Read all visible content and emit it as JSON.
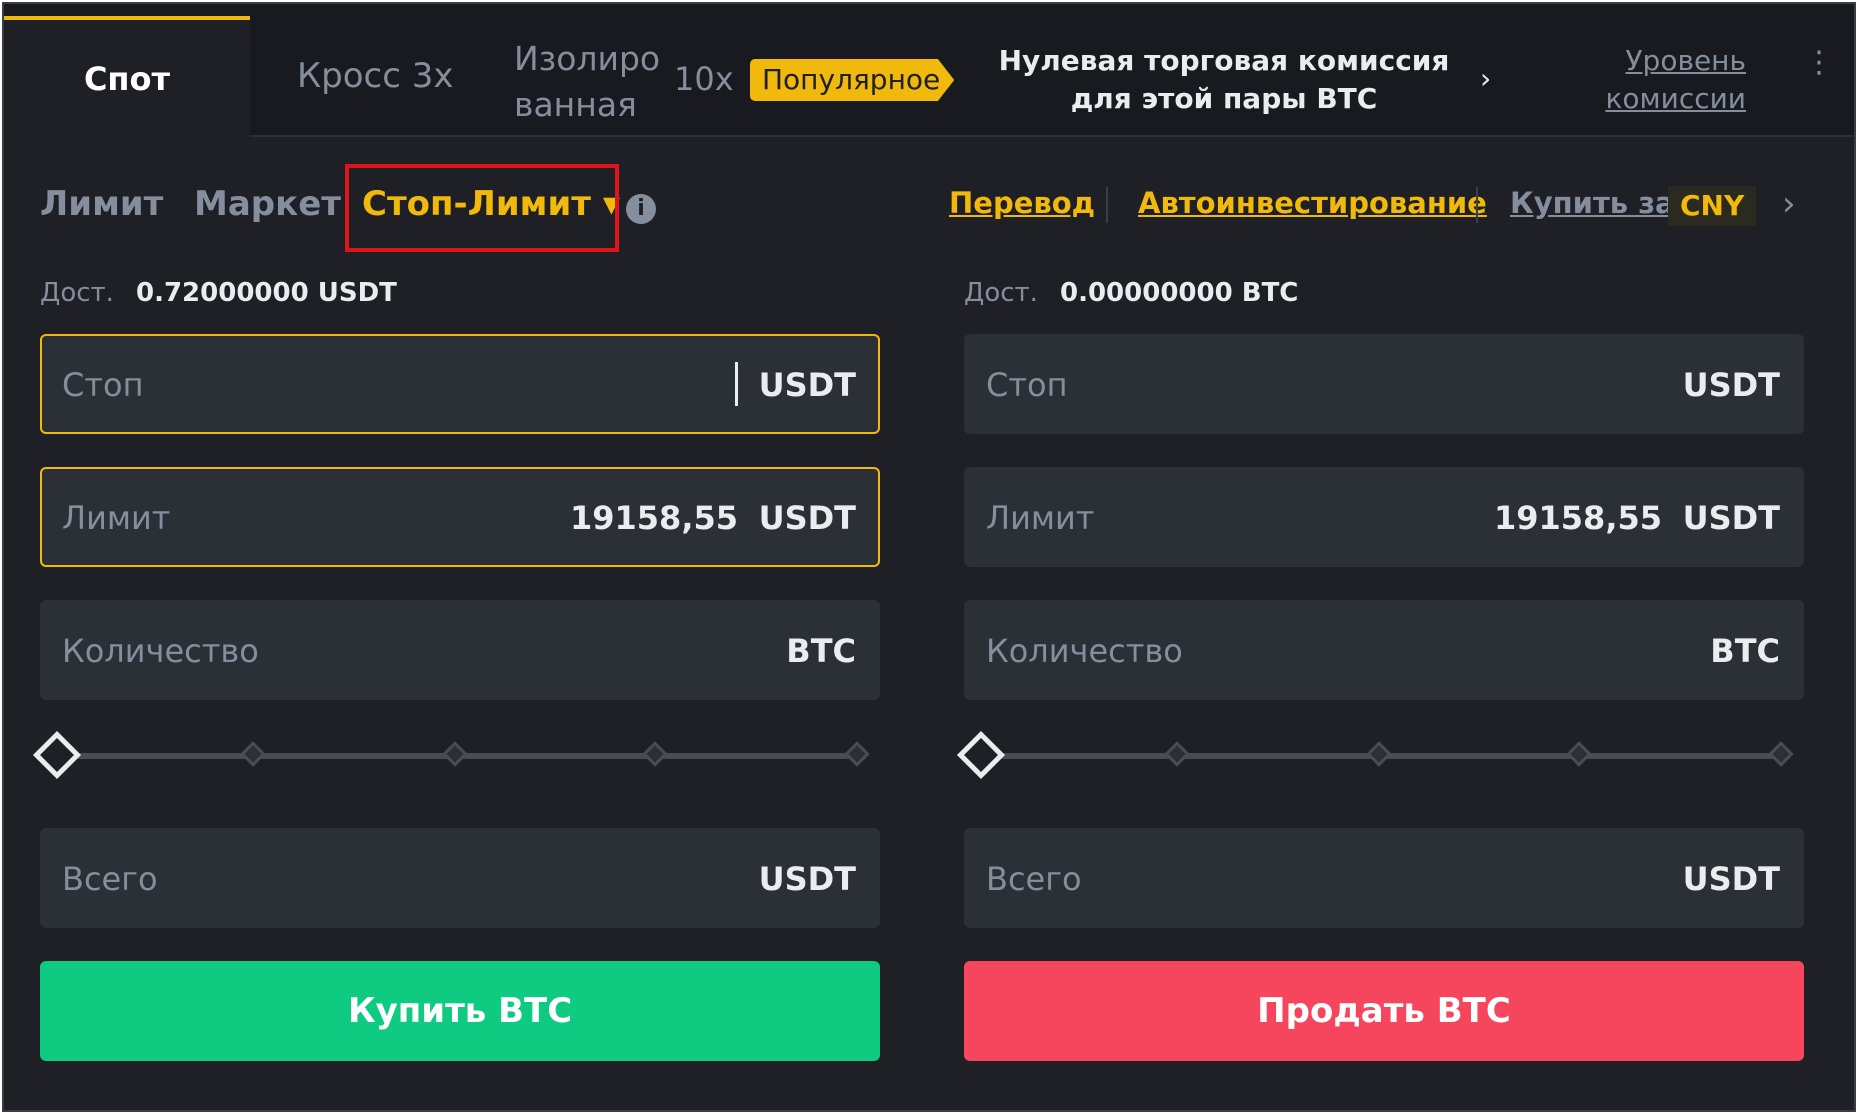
{
  "header": {
    "tab_spot": "Спот",
    "tab_cross": "Кросс 3x",
    "tab_isolated": "Изолиро ванная",
    "tab_isolated_leverage": "10x",
    "popular_badge": "Популярное",
    "promo_text": "Нулевая торговая комиссия для этой пары BTC",
    "promo_arrow": "›",
    "fee_level": "Уровень комиссии",
    "more": "⋮"
  },
  "order_types": {
    "limit": "Лимит",
    "market": "Маркет",
    "stop_limit": "Стоп-Лимит ▾",
    "info": "i"
  },
  "links": {
    "transfer": "Перевод",
    "auto_invest": "Автоинвестирование",
    "buy_with": "Купить за",
    "currency": "CNY",
    "next": "›"
  },
  "buy": {
    "avail_label": "Дост.",
    "avail_value": "0.72000000 USDT",
    "stop_placeholder": "Стоп",
    "stop_unit": "USDT",
    "limit_placeholder": "Лимит",
    "limit_value": "19158,55",
    "limit_unit": "USDT",
    "amount_placeholder": "Количество",
    "amount_unit": "BTC",
    "slider_percent": 0,
    "total_placeholder": "Всего",
    "total_unit": "USDT",
    "button": "Купить BTC"
  },
  "sell": {
    "avail_label": "Дост.",
    "avail_value": "0.00000000 BTC",
    "stop_placeholder": "Стоп",
    "stop_unit": "USDT",
    "limit_placeholder": "Лимит",
    "limit_value": "19158,55",
    "limit_unit": "USDT",
    "amount_placeholder": "Количество",
    "amount_unit": "BTC",
    "slider_percent": 0,
    "total_placeholder": "Всего",
    "total_unit": "USDT",
    "button": "Продать BTC"
  },
  "colors": {
    "background": "#1e2026",
    "accent": "#f0b90b",
    "buy": "#0ecb81",
    "sell": "#f6465d",
    "highlight_box": "#e0151b"
  }
}
